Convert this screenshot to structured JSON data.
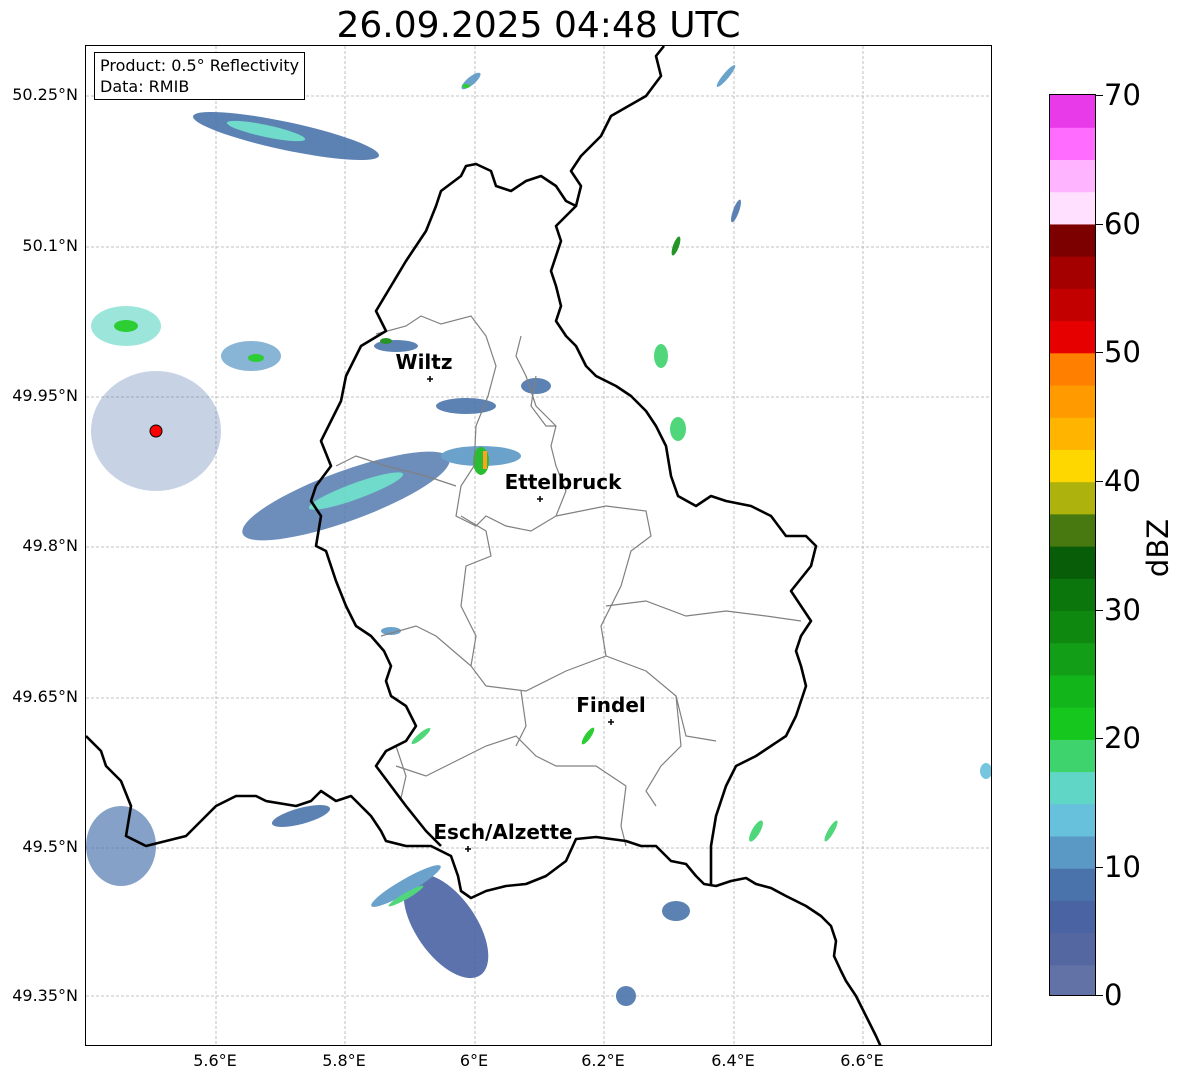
{
  "title": "26.09.2025 04:48 UTC",
  "info": {
    "product": "Product: 0.5° Reflectivity",
    "data_source": "Data: RMIB"
  },
  "axes": {
    "lat_labels": [
      "50.25°N",
      "50.1°N",
      "49.95°N",
      "49.8°N",
      "49.65°N",
      "49.5°N",
      "49.35°N"
    ],
    "lon_labels": [
      "5.6°E",
      "5.8°E",
      "6°E",
      "6.2°E",
      "6.4°E",
      "6.6°E"
    ]
  },
  "colorbar": {
    "label": "dBZ",
    "ticks": [
      "70",
      "60",
      "50",
      "40",
      "30",
      "20",
      "10",
      "0"
    ],
    "colors": [
      "#6372a6",
      "#5467a1",
      "#4a63a3",
      "#4a73ab",
      "#5a98c6",
      "#67c0dc",
      "#60d6c6",
      "#3ed36c",
      "#16c81e",
      "#12b51a",
      "#129e16",
      "#0f8810",
      "#0b760c",
      "#085d09",
      "#477910",
      "#adb30c",
      "#ffd700",
      "#ffb400",
      "#ff9a00",
      "#ff8000",
      "#e60000",
      "#c20000",
      "#a40000",
      "#7c0000",
      "#ffe0ff",
      "#ffb4ff",
      "#ff6cff",
      "#e93ae9"
    ]
  },
  "cities": [
    {
      "name": "Wiltz"
    },
    {
      "name": "Ettelbruck"
    },
    {
      "name": "Findel"
    },
    {
      "name": "Esch/Alzette"
    }
  ],
  "radar_site_color": "#ff0000",
  "border_color": "#000000",
  "canton_color": "#808080"
}
